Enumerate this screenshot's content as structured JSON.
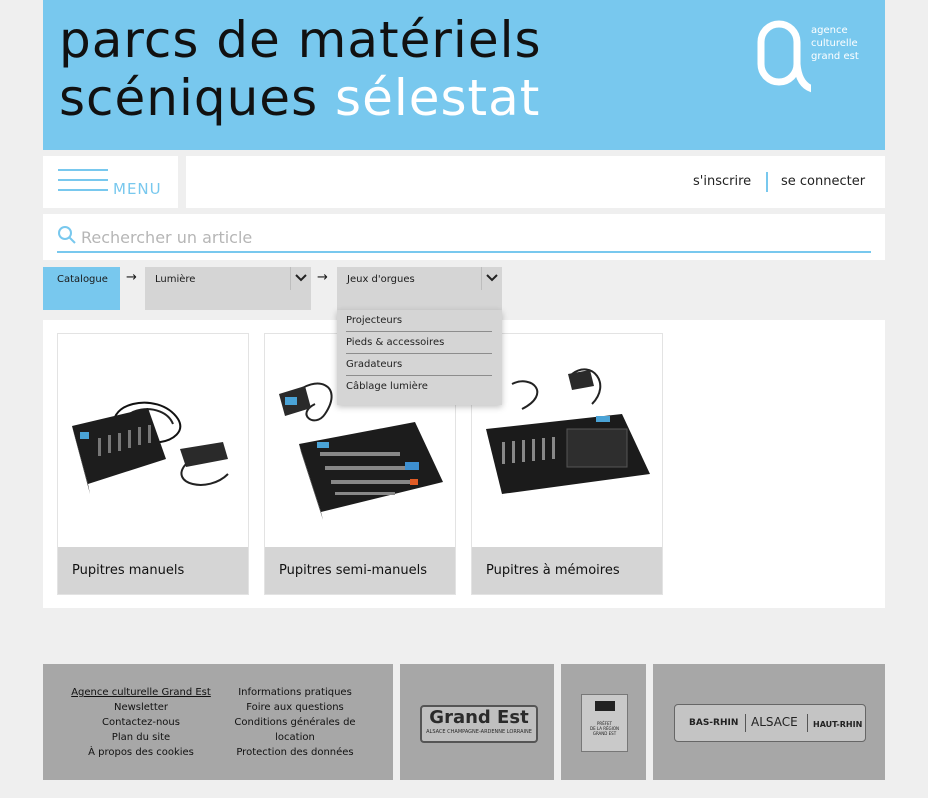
{
  "header": {
    "title_line1": "parcs de matériels",
    "title_line2_dark": "scéniques",
    "title_line2_light": "sélestat",
    "logo_lines": [
      "agence",
      "culturelle",
      "grand est"
    ]
  },
  "nav": {
    "menu_label": "MENU",
    "signup": "s'inscrire",
    "login": "se connecter"
  },
  "search": {
    "placeholder": "Rechercher un article"
  },
  "breadcrumb": {
    "root": "Catalogue",
    "level1": "Lumière",
    "level2": "Jeux d'orgues"
  },
  "dropdown": {
    "options": [
      "Projecteurs",
      "Pieds & accessoires",
      "Gradateurs",
      "Câblage lumière"
    ]
  },
  "products": [
    {
      "name": "Pupitres manuels"
    },
    {
      "name": "Pupitres semi-manuels"
    },
    {
      "name": "Pupitres à mémoires"
    }
  ],
  "footer": {
    "col1": [
      "Agence culturelle Grand Est",
      "Newsletter",
      "Contactez-nous",
      "Plan du site",
      "À propos des cookies"
    ],
    "col2": [
      "Informations pratiques",
      "Foire aux questions",
      "Conditions générales de",
      "location",
      "Protection des données"
    ],
    "logo_grandest": "Grand Est",
    "logo_grandest_sub": "ALSACE CHAMPAGNE-ARDENNE LORRAINE",
    "logo_prefet_lines": [
      "PRÉFET",
      "DE LA RÉGION",
      "GRAND EST"
    ],
    "logo_basrhin": "BAS-RHIN",
    "logo_alsace": "ALSACE",
    "logo_hautrhin": "HAUT-RHIN"
  },
  "colors": {
    "accent": "#78c8ee",
    "panel": "#d5d5d5",
    "footer": "#a7a7a7",
    "page": "#efefef"
  }
}
